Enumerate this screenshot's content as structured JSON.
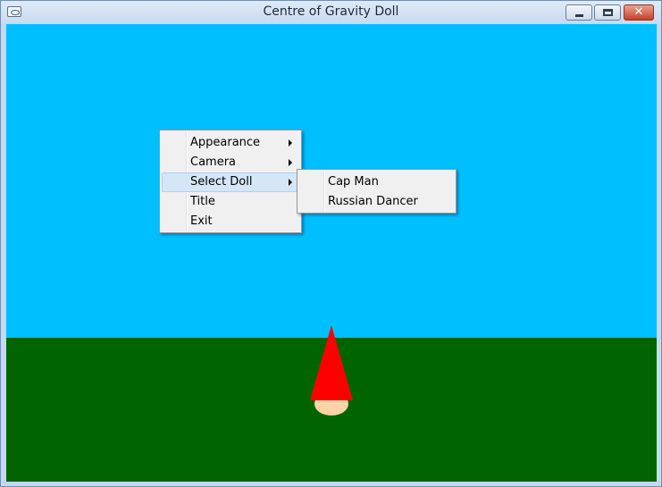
{
  "window": {
    "title": "Centre of Gravity Doll"
  },
  "colors": {
    "sky": "#00bfff",
    "ground": "#006400",
    "hat": "#ff0000",
    "face": "#ffd3a8"
  },
  "context_menu": {
    "items": [
      {
        "label": "Appearance",
        "has_submenu": true
      },
      {
        "label": "Camera",
        "has_submenu": true
      },
      {
        "label": "Select Doll",
        "has_submenu": true,
        "highlighted": true
      },
      {
        "label": "Title",
        "has_submenu": false
      },
      {
        "label": "Exit",
        "has_submenu": false
      }
    ]
  },
  "submenu": {
    "items": [
      {
        "label": "Cap Man"
      },
      {
        "label": "Russian Dancer"
      }
    ]
  }
}
